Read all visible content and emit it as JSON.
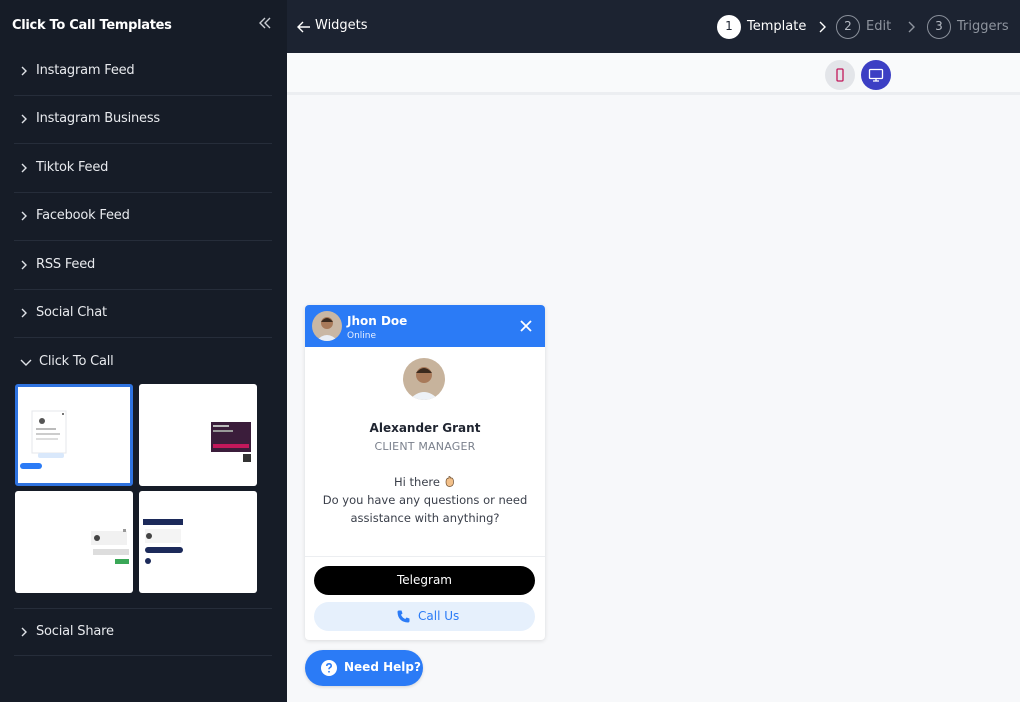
{
  "sidebar": {
    "title": "Click To Call Templates",
    "items": [
      {
        "label": "Instagram Feed"
      },
      {
        "label": "Instagram Business"
      },
      {
        "label": "Tiktok Feed"
      },
      {
        "label": "Facebook Feed"
      },
      {
        "label": "RSS Feed"
      },
      {
        "label": "Social Chat"
      },
      {
        "label": "Click To Call",
        "expanded": true
      },
      {
        "label": "Social Share"
      }
    ],
    "templates_selected_index": 0
  },
  "topbar": {
    "back_label": "Widgets",
    "steps": [
      {
        "number": "1",
        "label": "Template",
        "active": true
      },
      {
        "number": "2",
        "label": "Edit",
        "active": false
      },
      {
        "number": "3",
        "label": "Triggers",
        "active": false
      }
    ]
  },
  "preview": {
    "device_selected": "desktop",
    "widget": {
      "header_name": "Jhon Doe",
      "header_status": "Online",
      "agent_name": "Alexander Grant",
      "agent_role": "CLIENT MANAGER",
      "greeting": "Hi there",
      "message_line1": "Do you have any questions or need",
      "message_line2": "assistance with anything?",
      "telegram_label": "Telegram",
      "call_label": "Call Us",
      "accent_color": "#2b7bf6"
    },
    "help_button_label": "Need Help?"
  }
}
